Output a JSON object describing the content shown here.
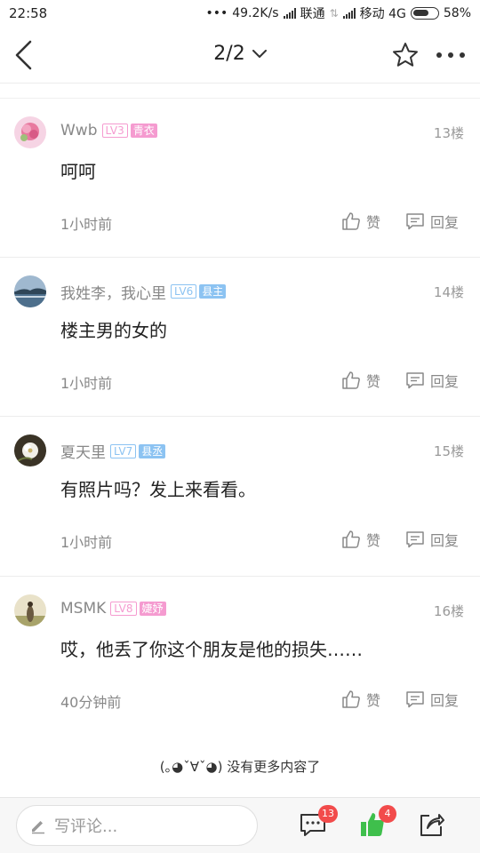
{
  "status_bar": {
    "time": "22:58",
    "dots": "•••",
    "speed": "49.2K/s",
    "carrier1": "联通",
    "carrier2": "移动 4G",
    "battery": "58%"
  },
  "header": {
    "page_indicator": "2/2"
  },
  "posts": [
    {
      "username": "Wwb",
      "level": "LV3",
      "title": "青衣",
      "badge_color": "#f59bd0",
      "floor": "13楼",
      "text": "呵呵",
      "time": "1小时前",
      "like_label": "赞",
      "reply_label": "回复"
    },
    {
      "username": "我姓李，我心里",
      "level": "LV6",
      "title": "县主",
      "badge_color": "#8cc3f2",
      "floor": "14楼",
      "text": "楼主男的女的",
      "time": "1小时前",
      "like_label": "赞",
      "reply_label": "回复"
    },
    {
      "username": "夏天里",
      "level": "LV7",
      "title": "县丞",
      "badge_color": "#8cc3f2",
      "floor": "15楼",
      "text": "有照片吗？发上来看看。",
      "time": "1小时前",
      "like_label": "赞",
      "reply_label": "回复"
    },
    {
      "username": "MSMK",
      "level": "LV8",
      "title": "婕妤",
      "badge_color": "#f59bd0",
      "floor": "16楼",
      "text": "哎，他丢了你这个朋友是他的损失……",
      "time": "40分钟前",
      "like_label": "赞",
      "reply_label": "回复"
    }
  ],
  "end_note": "(｡◕ˇ∀ˇ◕) 没有更多内容了",
  "bottom_bar": {
    "comment_placeholder": "写评论...",
    "comment_count": "13",
    "like_count": "4"
  },
  "colors": {
    "like_green": "#3fbf4c",
    "badge_red": "#f24b4b"
  }
}
